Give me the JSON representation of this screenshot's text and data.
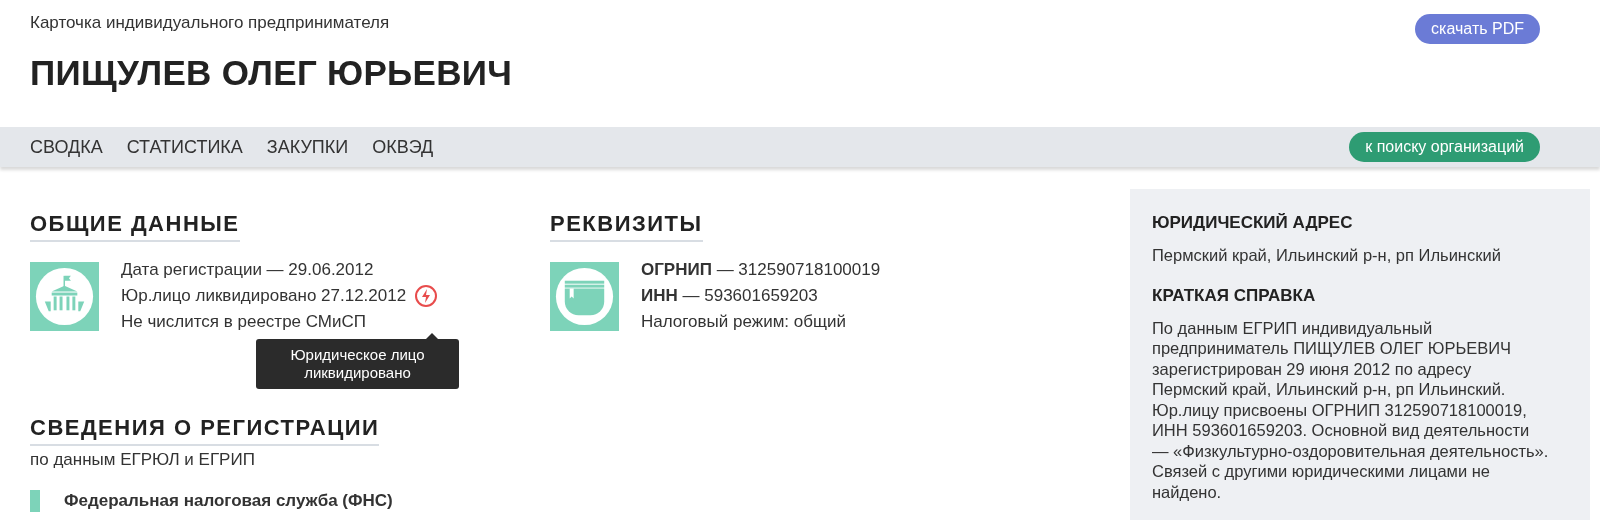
{
  "header": {
    "subtitle": "Карточка индивидуального предпринимателя",
    "name": "ПИЩУЛЕВ ОЛЕГ ЮРЬЕВИЧ",
    "pdf_button": "скачать PDF"
  },
  "nav": {
    "items": [
      {
        "label": "СВОДКА"
      },
      {
        "label": "СТАТИСТИКА"
      },
      {
        "label": "ЗАКУПКИ"
      },
      {
        "label": "ОКВЭД"
      }
    ],
    "search_button": "к поиску организаций"
  },
  "general": {
    "title": "ОБЩИЕ ДАННЫЕ",
    "registered": "Дата регистрации — 29.06.2012",
    "liquidated": "Юр.лицо ликвидировано 27.12.2012",
    "smisp": "Не числится в реестре СМиСП",
    "tooltip": "Юридическое лицо ликвидировано"
  },
  "requisites": {
    "title": "РЕКВИЗИТЫ",
    "lines": [
      {
        "text": "**ОГРНИП** — 312590718100019"
      },
      {
        "text": "**ИНН** — 593601659203"
      },
      {
        "text": "Налоговый режим: общий"
      }
    ]
  },
  "registration": {
    "title": "СВЕДЕНИЯ О РЕГИСТРАЦИИ",
    "subtitle": "по данным ЕГРЮЛ и ЕГРИП",
    "items": [
      {
        "label": "Федеральная налоговая служба (ФНС)"
      }
    ]
  },
  "sidebar": {
    "sections": [
      {
        "title": "ЮРИДИЧЕСКИЙ АДРЕС",
        "text": "Пермский край, Ильинский р-н, рп Ильинский"
      },
      {
        "title": "КРАТКАЯ СПРАВКА",
        "text": "По данным ЕГРИП индивидуальный предприниматель ПИЩУЛЕВ ОЛЕГ ЮРЬЕВИЧ зарегистрирован 29 июня 2012 по адресу Пермский край, Ильинский р-н, рп Ильинский. Юр.лицу присвоены ОГРНИП 312590718100019, ИНН 593601659203. Основной вид деятельности — «Физкультурно-оздоровительная деятельность». Связей с другими юридическими лицами не найдено."
      }
    ]
  }
}
